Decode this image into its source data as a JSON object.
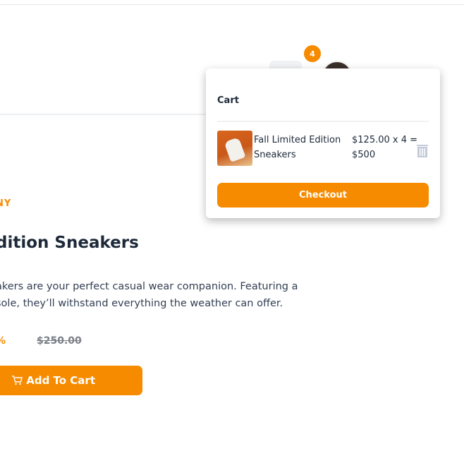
{
  "header": {
    "cart_count": "4"
  },
  "cart": {
    "title": "Cart",
    "items": [
      {
        "name": "Fall Limited Edition Sneakers",
        "price_line": "$125.00 x 4 =",
        "total": "$500"
      }
    ],
    "checkout_label": "Checkout"
  },
  "product": {
    "company": "NY",
    "title": "dition Sneakers",
    "description_line1": "akers are your perfect casual wear companion. Featuring a",
    "description_line2": "sole, they’ll withstand everything the weather can offer.",
    "discount": "%",
    "original_price": "$250.00",
    "add_to_cart_label": "Add To Cart"
  },
  "colors": {
    "accent": "#f68b00",
    "text": "#1d2939"
  }
}
